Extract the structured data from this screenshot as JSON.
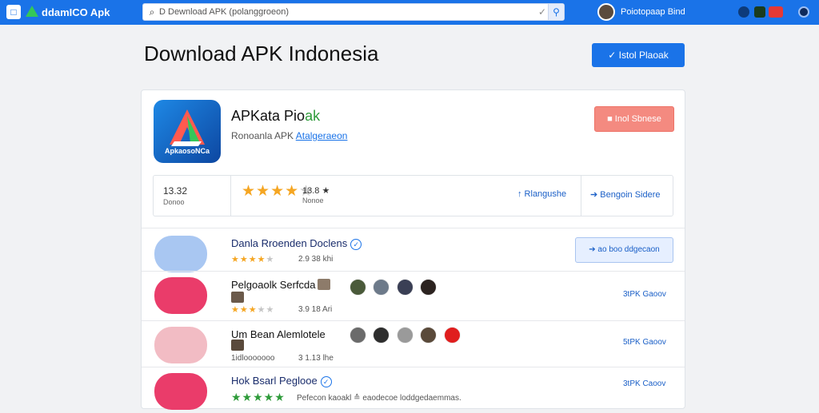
{
  "topbar": {
    "logo_glyph": "□",
    "brand": "ddamICO Apk",
    "search_value": "D Dewnload APK (polanggroeon)",
    "user_name": "Poiotopaap Bind"
  },
  "header": {
    "title": "Download APK Indonesia",
    "install_label": "✓ Istol Plaoak"
  },
  "app": {
    "icon_label": "ApkaosoNCa",
    "name_main": "APKata Pio",
    "name_accent": "ak",
    "subtitle": "Ronoanla APK",
    "subtitle_link": "Atalgeraeon",
    "report_label": "■ Inol Sbnese"
  },
  "stats": {
    "size_value": "13.32",
    "size_label": "Donoo",
    "rating_value": "13.8 ★",
    "rating_label": "Nonoe",
    "rating": 4,
    "link1": "↑ Rlangushe",
    "link2": "➔ Bengoin Sidere"
  },
  "list": [
    {
      "title": "Danla Rroenden Doclens",
      "meta": "2.9 38 khi",
      "rating": 4,
      "button": "➔ ao boo ddgecaon",
      "icon_color": "#a9c7f2"
    },
    {
      "title": "Pelgoaolk Serfcda",
      "meta": "3.9 18 Ari",
      "rating": 3,
      "link": "3tPK Gaoov",
      "icon_color": "#ea3c6a"
    },
    {
      "title": "Um Bean Alemlotele",
      "meta_left": "1idlooooooo",
      "meta": "3 1.13 lhe",
      "link": "5tPK Gaoov",
      "icon_color": "#f2bcc4"
    },
    {
      "title": "Hok Bsarl Peglooe",
      "meta": "Pefecon kaoakl ≙ eaodecoe loddgedaemmas.",
      "rating": 5,
      "link": "3tPK Caoov",
      "icon_color": "#ea3c6a"
    }
  ],
  "colors": {
    "topbar": "#1a73e8",
    "star": "#f5a623",
    "accent_green": "#2e9b3a",
    "report": "#f48a80"
  }
}
